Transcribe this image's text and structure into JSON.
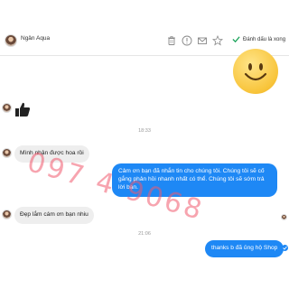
{
  "header": {
    "contact_name": "Ngân Aqua",
    "mark_done_label": "Đánh dấu là xong",
    "icons": [
      "trash-icon",
      "alert-icon",
      "mail-icon",
      "star-icon",
      "check-icon"
    ]
  },
  "accent": "#1e88f5",
  "messages": {
    "time_1": "18:33",
    "incoming_1": "Mình nhận được hoa rồi",
    "outgoing_1": "Cảm ơn bạn đã nhắn tin cho chúng tôi. Chúng tôi sẽ cố gắng phản hồi nhanh nhất có thể. Chúng tôi sẽ sớm trả lời bạn.",
    "incoming_2": "Đẹp lắm cám ơn bạn nhiu",
    "time_2": "21:06",
    "outgoing_2": "thanks b đã ủng hộ Shop"
  },
  "watermark": "097 4 9068"
}
